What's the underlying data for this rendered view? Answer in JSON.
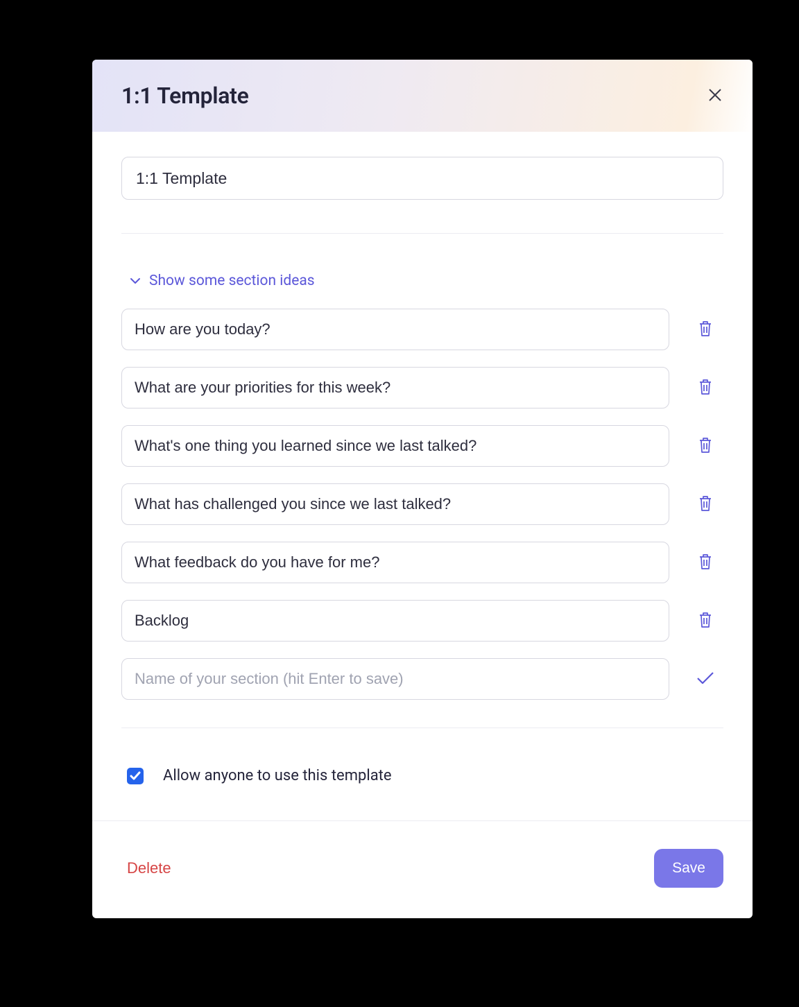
{
  "header": {
    "title": "1:1 Template"
  },
  "form": {
    "template_name": "1:1 Template",
    "ideas_label": "Show some section ideas",
    "sections": [
      {
        "value": "How are you today?"
      },
      {
        "value": "What are your priorities for this week?"
      },
      {
        "value": "What's one thing you learned since we last talked?"
      },
      {
        "value": "What has challenged you since we last talked?"
      },
      {
        "value": "What feedback do you have for me?"
      },
      {
        "value": "Backlog"
      }
    ],
    "new_section_placeholder": "Name of your section (hit Enter to save)",
    "allow_anyone_label": "Allow anyone to use this template",
    "allow_anyone_checked": true
  },
  "footer": {
    "delete_label": "Delete",
    "save_label": "Save"
  }
}
